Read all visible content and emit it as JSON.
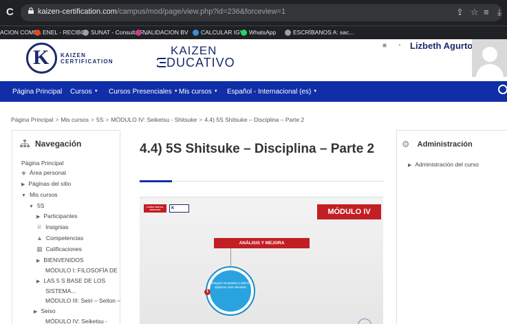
{
  "browser": {
    "url_host": "kaizen-certification.com",
    "url_path": "/campus/mod/page/view.php?id=236&forceview=1",
    "bookmarks": [
      {
        "label": "ACION COMP...",
        "color": ""
      },
      {
        "label": "ENEL - RECIBO",
        "color": "#e2471d"
      },
      {
        "label": "SUNAT - Consulta R...",
        "color": "#9aa0a6"
      },
      {
        "label": "VALIDACION BV",
        "color": "#c43b8e"
      },
      {
        "label": "CALCULAR IGV",
        "color": "#3a8fd9"
      },
      {
        "label": "WhatsApp",
        "color": "#25d366"
      },
      {
        "label": "ESCRÍBANOS A: sac...",
        "color": "#9aa0a6"
      }
    ]
  },
  "header": {
    "brand_line1": "KAIZEN",
    "brand_line2": "CERTIFICATION",
    "edu_line1": "KAIZEN",
    "edu_line2": "EDUCATIVO",
    "user_name": "Lizbeth Agurto",
    "user_caret": "▾"
  },
  "navbar": {
    "items": [
      {
        "label": "Página Principal",
        "caret": false
      },
      {
        "label": "Cursos",
        "caret": true
      },
      {
        "label": "Cursos Presenciales",
        "caret": true
      },
      {
        "label": "Mis cursos",
        "caret": true
      },
      {
        "label": "Español - Internacional (es)",
        "caret": true
      }
    ]
  },
  "breadcrumb": [
    "Página Principal",
    "Mis cursos",
    "5S",
    "MÓDULO IV: Seiketsu - Shitsuke",
    "4.4) 5S Shitsuke – Disciplina – Parte 2"
  ],
  "navigation": {
    "title": "Navegación",
    "items": [
      {
        "label": "Página Principal",
        "indent": 0,
        "marker": "none"
      },
      {
        "label": "Área personal",
        "indent": 0,
        "marker": "dash-icon"
      },
      {
        "label": "Páginas del sitio",
        "indent": 0,
        "marker": "collapsed"
      },
      {
        "label": "Mis cursos",
        "indent": 0,
        "marker": "expanded"
      },
      {
        "label": "5S",
        "indent": 1,
        "marker": "expanded"
      },
      {
        "label": "Participantes",
        "indent": 2,
        "marker": "collapsed"
      },
      {
        "label": "Insignias",
        "indent": 2,
        "marker": "badge-icon"
      },
      {
        "label": "Competencias",
        "indent": 2,
        "marker": "competency-icon"
      },
      {
        "label": "Calificaciones",
        "indent": 2,
        "marker": "grades-icon"
      },
      {
        "label": "BIENVENIDOS",
        "indent": 2,
        "marker": "collapsed"
      },
      {
        "label": "MÓDULO I: FILOSOFÍA DE",
        "indent": 2,
        "marker": "none"
      },
      {
        "label": "LAS 5 S BASE DE LOS",
        "indent": 2,
        "marker": "collapsed"
      },
      {
        "label": "SISTEMA...",
        "indent": 2,
        "marker": "none"
      },
      {
        "label": "MÓDULO III: Seiri – Seiton –",
        "indent": 2,
        "marker": "none"
      },
      {
        "label": "Seiso",
        "indent": 2,
        "marker": "collapsed-mid"
      },
      {
        "label": "MÓDULO IV: Seiketsu -",
        "indent": 2,
        "marker": "none"
      }
    ]
  },
  "main": {
    "title": "4.4) 5S Shitsuke – Disciplina – Parte 2"
  },
  "video": {
    "badge": "CURSO VIRTUAL\nINSTITUTO",
    "logo": "K",
    "module": "MÓDULO IV",
    "section": "ANÁLISIS Y MEJORA",
    "circle_text": "Integrar resultados y definir objetivos más elevados",
    "step": "1"
  },
  "admin": {
    "title": "Administración",
    "items": [
      "Administración del curso"
    ]
  },
  "colors": {
    "navbar": "#0f2ea8",
    "brand_dark": "#1b2a6b",
    "accent_red": "#c21f24"
  }
}
